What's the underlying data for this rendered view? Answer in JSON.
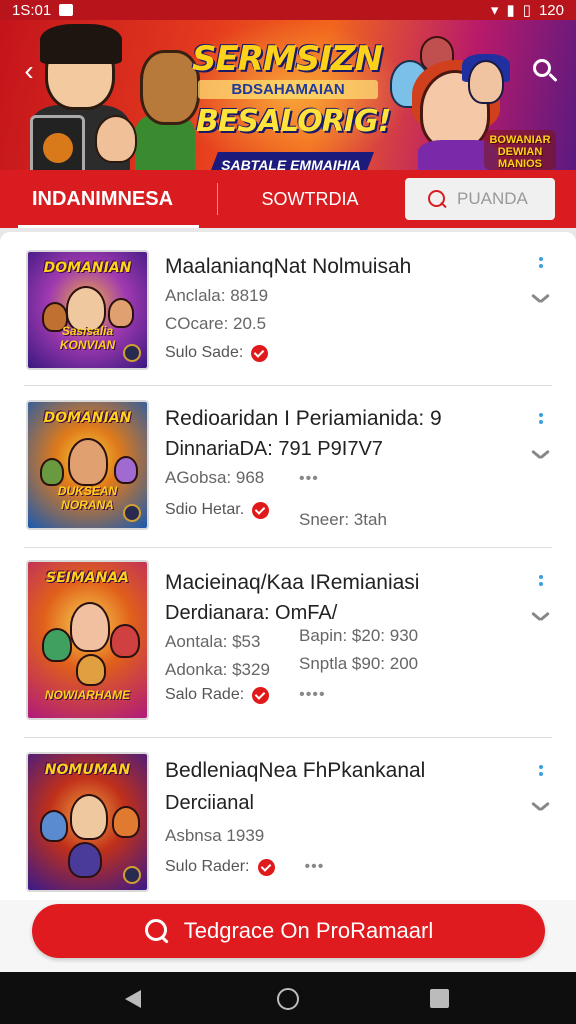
{
  "status_bar": {
    "time": "1S:01",
    "right_text": "120"
  },
  "banner": {
    "title": "SERMSIZN",
    "subtitle": "BDSAHAMAIAN",
    "title2": "BESALORIG!",
    "ribbon": "SABTALE EMMAIHIA",
    "badge": "BOWANIAR DEWIAN MANIOS"
  },
  "tabs": {
    "tab1": "INDANIMNESA",
    "tab2": "SOWTRDIA",
    "search_placeholder": "PUANDA"
  },
  "items": [
    {
      "title": "MaalanianqNat Nolmuisah",
      "line2": "Anclala: 8819",
      "line3": "COcare: 20.5",
      "seller": "Sulo Sade:",
      "thumb_logo": "DOMANIAN",
      "thumb_sub": "Sasisalia KONVIAN",
      "thumb_colors": [
        "#5a1e9a",
        "#e0401a"
      ]
    },
    {
      "title": "Redioaridan I Periamianida: 9",
      "line2": "DinnariaDA: 791 P9I7V7",
      "line3": "AGobsa: 968",
      "line3_dots": "•••",
      "seller": "Sdio Hetar.",
      "col2": "Sneer: 3tah",
      "thumb_logo": "DOMANIAN",
      "thumb_sub": "DUKSEAN NORANA",
      "thumb_colors": [
        "#1a5ab0",
        "#e07a1a"
      ]
    },
    {
      "title": "Macieinaq/Kaa IRemianiasi",
      "line2": "Derdianara:  OmFA/",
      "line3": "Aontala: $53",
      "line3_col2": "Bapin: $20: 930",
      "line4": "Adonka: $329",
      "line4_col2": "Snptla $90: 200",
      "seller": "Salo Rade:",
      "seller_dots": "••••",
      "thumb_logo": "SEIMANAA",
      "thumb_sub": "NOWIARHAME",
      "thumb_colors": [
        "#c01a7a",
        "#f0a01a"
      ]
    },
    {
      "title": "BedleniaqNea FhPkankanal",
      "line2": "Derciianal",
      "line3": "Asbnsa 1939",
      "seller": "Sulo Rader:",
      "seller_dots": "•••",
      "thumb_logo": "NOMUMAN",
      "thumb_sub": "",
      "thumb_colors": [
        "#3a1a8a",
        "#d0301a"
      ]
    }
  ],
  "cta": {
    "label": "Tedgrace On ProRamaarl"
  }
}
